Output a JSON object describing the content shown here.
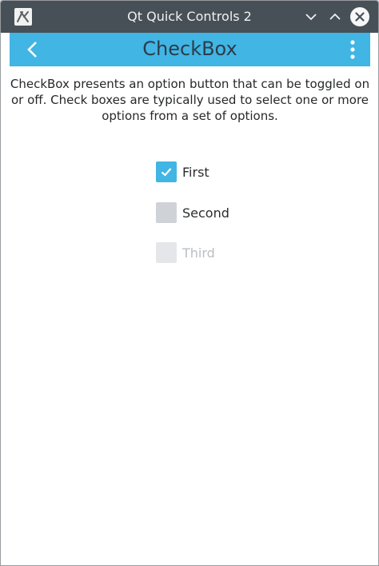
{
  "window": {
    "title": "Qt Quick Controls 2",
    "icons": {
      "app": "qt-app-icon",
      "minimize": "chevron-down-icon",
      "maximize": "chevron-up-icon",
      "close": "close-icon"
    }
  },
  "toolbar": {
    "title": "CheckBox",
    "back_icon": "chevron-left-icon",
    "menu_icon": "vertical-dots-icon",
    "color": "#41b5e4"
  },
  "content": {
    "description": "CheckBox presents an option button that can be toggled on or off. Check boxes are typically used to select one or more options from a set of options.",
    "checkboxes": [
      {
        "label": "First",
        "checked": true,
        "enabled": true
      },
      {
        "label": "Second",
        "checked": false,
        "enabled": true
      },
      {
        "label": "Third",
        "checked": false,
        "enabled": false
      }
    ]
  },
  "colors": {
    "accent": "#41b5e4",
    "titlebar": "#475057",
    "text": "#26282a",
    "disabled_text": "#b9bfc5"
  }
}
